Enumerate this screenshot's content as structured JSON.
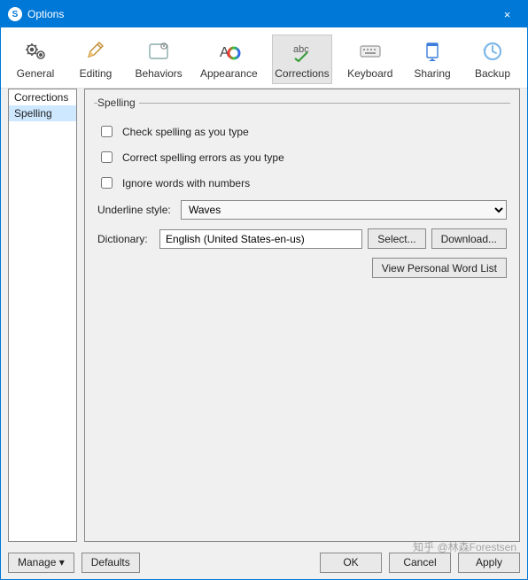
{
  "titlebar": {
    "app_letter": "S",
    "title": "Options",
    "close": "×"
  },
  "toolbar": [
    {
      "id": "general",
      "label": "General"
    },
    {
      "id": "editing",
      "label": "Editing"
    },
    {
      "id": "behaviors",
      "label": "Behaviors"
    },
    {
      "id": "appearance",
      "label": "Appearance"
    },
    {
      "id": "corrections",
      "label": "Corrections",
      "active": true
    },
    {
      "id": "keyboard",
      "label": "Keyboard"
    },
    {
      "id": "sharing",
      "label": "Sharing"
    },
    {
      "id": "backup",
      "label": "Backup"
    }
  ],
  "sidebar": {
    "items": [
      "Corrections",
      "Spelling"
    ],
    "selected_index": 1
  },
  "group": {
    "legend": "Spelling"
  },
  "checks": {
    "as_type": "Check spelling as you type",
    "correct": "Correct spelling errors as you type",
    "ignore_num": "Ignore words with numbers"
  },
  "underline": {
    "label": "Underline style:",
    "value": "Waves"
  },
  "dictionary": {
    "label": "Dictionary:",
    "value": "English (United States-en-us)",
    "select": "Select...",
    "download": "Download..."
  },
  "personal_list": "View Personal Word List",
  "footer": {
    "manage": "Manage  ▾",
    "defaults": "Defaults",
    "ok": "OK",
    "cancel": "Cancel",
    "apply": "Apply"
  },
  "watermark": "知乎 @林森Forestsen"
}
